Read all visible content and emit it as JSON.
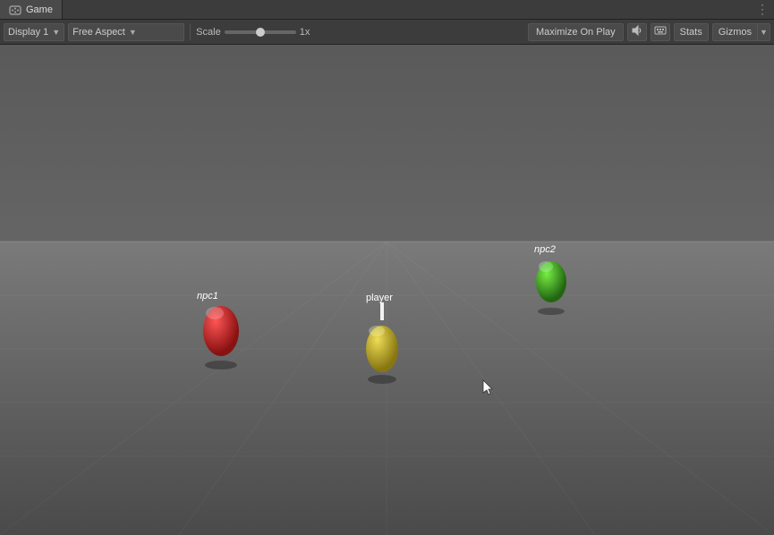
{
  "tab": {
    "icon": "🎮",
    "label": "Game",
    "dots": "⋮"
  },
  "toolbar": {
    "display_label": "Display 1",
    "aspect_label": "Free Aspect",
    "scale_label": "Scale",
    "scale_value": "1x",
    "maximize_label": "Maximize On Play",
    "audio_icon": "🔊",
    "keyboard_icon": "⌨",
    "stats_label": "Stats",
    "gizmos_label": "Gizmos"
  },
  "scene": {
    "npc1_label": "npc1",
    "npc2_label": "npc2",
    "player_label": "player"
  },
  "colors": {
    "bg": "#4a4a4a",
    "ground": "#5a5a5a",
    "npc1": "#cc2222",
    "npc2": "#44bb22",
    "player": "#ccaa22",
    "toolbar_bg": "#3c3c3c"
  }
}
